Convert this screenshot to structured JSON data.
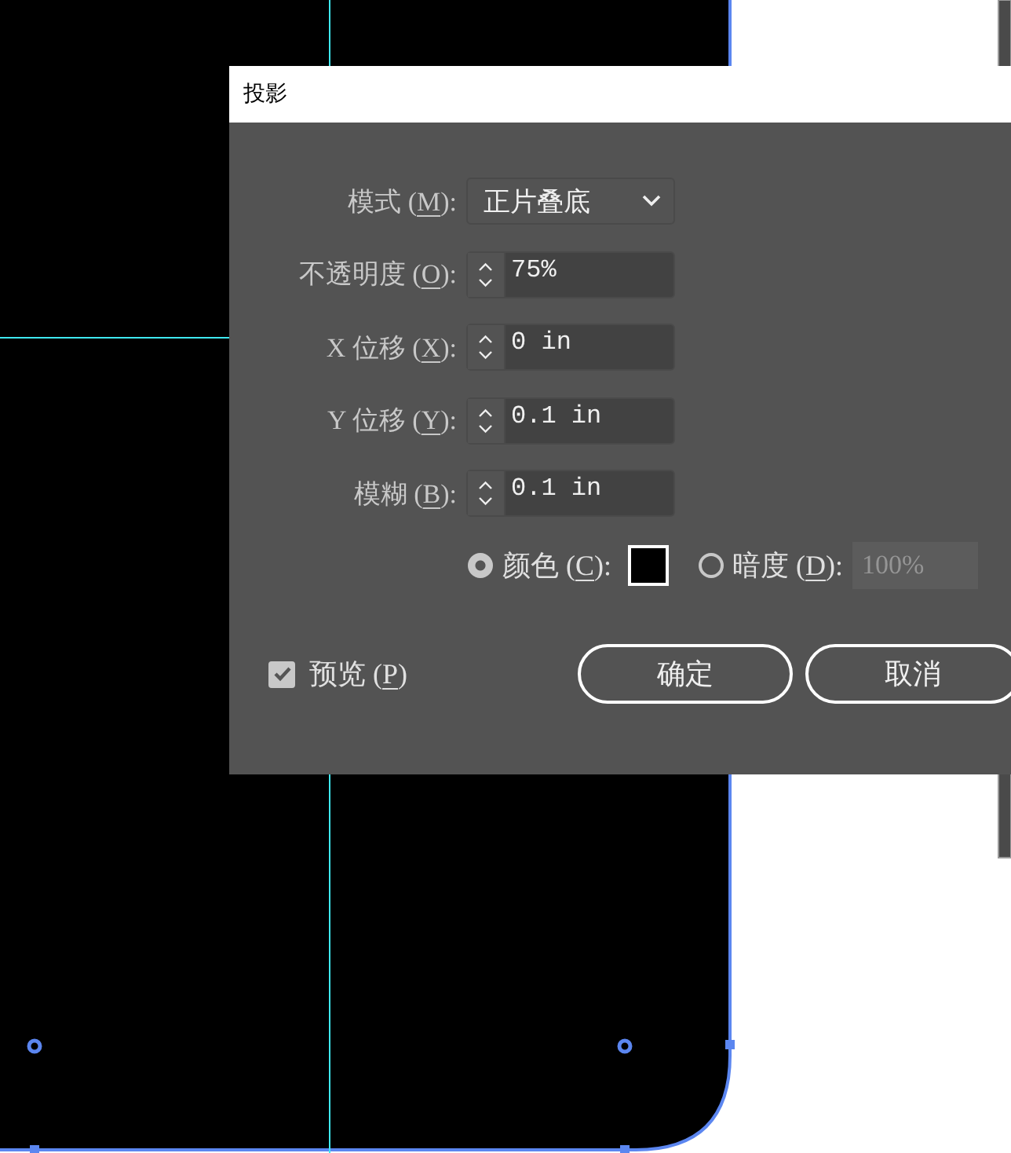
{
  "dialog": {
    "title": "投影",
    "fields": [
      {
        "kind": "dropdown",
        "label": "模式 (M):",
        "value": "正片叠底"
      },
      {
        "kind": "spinner",
        "label": "不透明度 (O):",
        "value": "75%"
      },
      {
        "kind": "spinner",
        "label": "X 位移 (X):",
        "value": "0 in"
      },
      {
        "kind": "spinner",
        "label": "Y 位移 (Y):",
        "value": "0.1 in"
      },
      {
        "kind": "spinner",
        "label": "模糊 (B):",
        "value": "0.1 in"
      }
    ],
    "shadow_options": [
      {
        "kind": "swatch",
        "label": "颜色 (C):",
        "selected": true
      },
      {
        "kind": "field",
        "label": "暗度 (D):",
        "selected": false,
        "value": "100%",
        "disabled": true
      }
    ],
    "preview": {
      "label": "预览 (P)",
      "checked": true
    },
    "buttons": [
      {
        "label": "确定"
      },
      {
        "label": "取消"
      }
    ]
  }
}
